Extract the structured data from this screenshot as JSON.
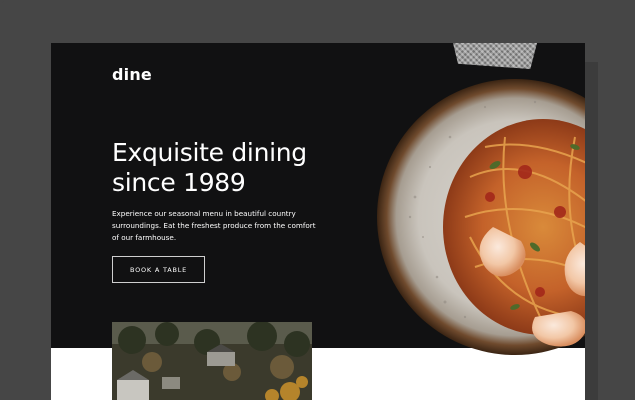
{
  "header": {
    "logo": "dine"
  },
  "hero": {
    "headline_line1": "Exquisite dining",
    "headline_line2": "since 1989",
    "description": "Experience our seasonal menu in beautiful country surroundings. Eat the freshest produce from the comfort of our farmhouse.",
    "cta_label": "BOOK A TABLE"
  },
  "images": {
    "hero_dish": "shrimp-pasta-plate",
    "farmhouse": "countryside-farmhouse-photo"
  },
  "colors": {
    "hero_background": "#111112",
    "page_background": "#ffffff",
    "outer_background": "#464646",
    "text": "#ffffff"
  }
}
